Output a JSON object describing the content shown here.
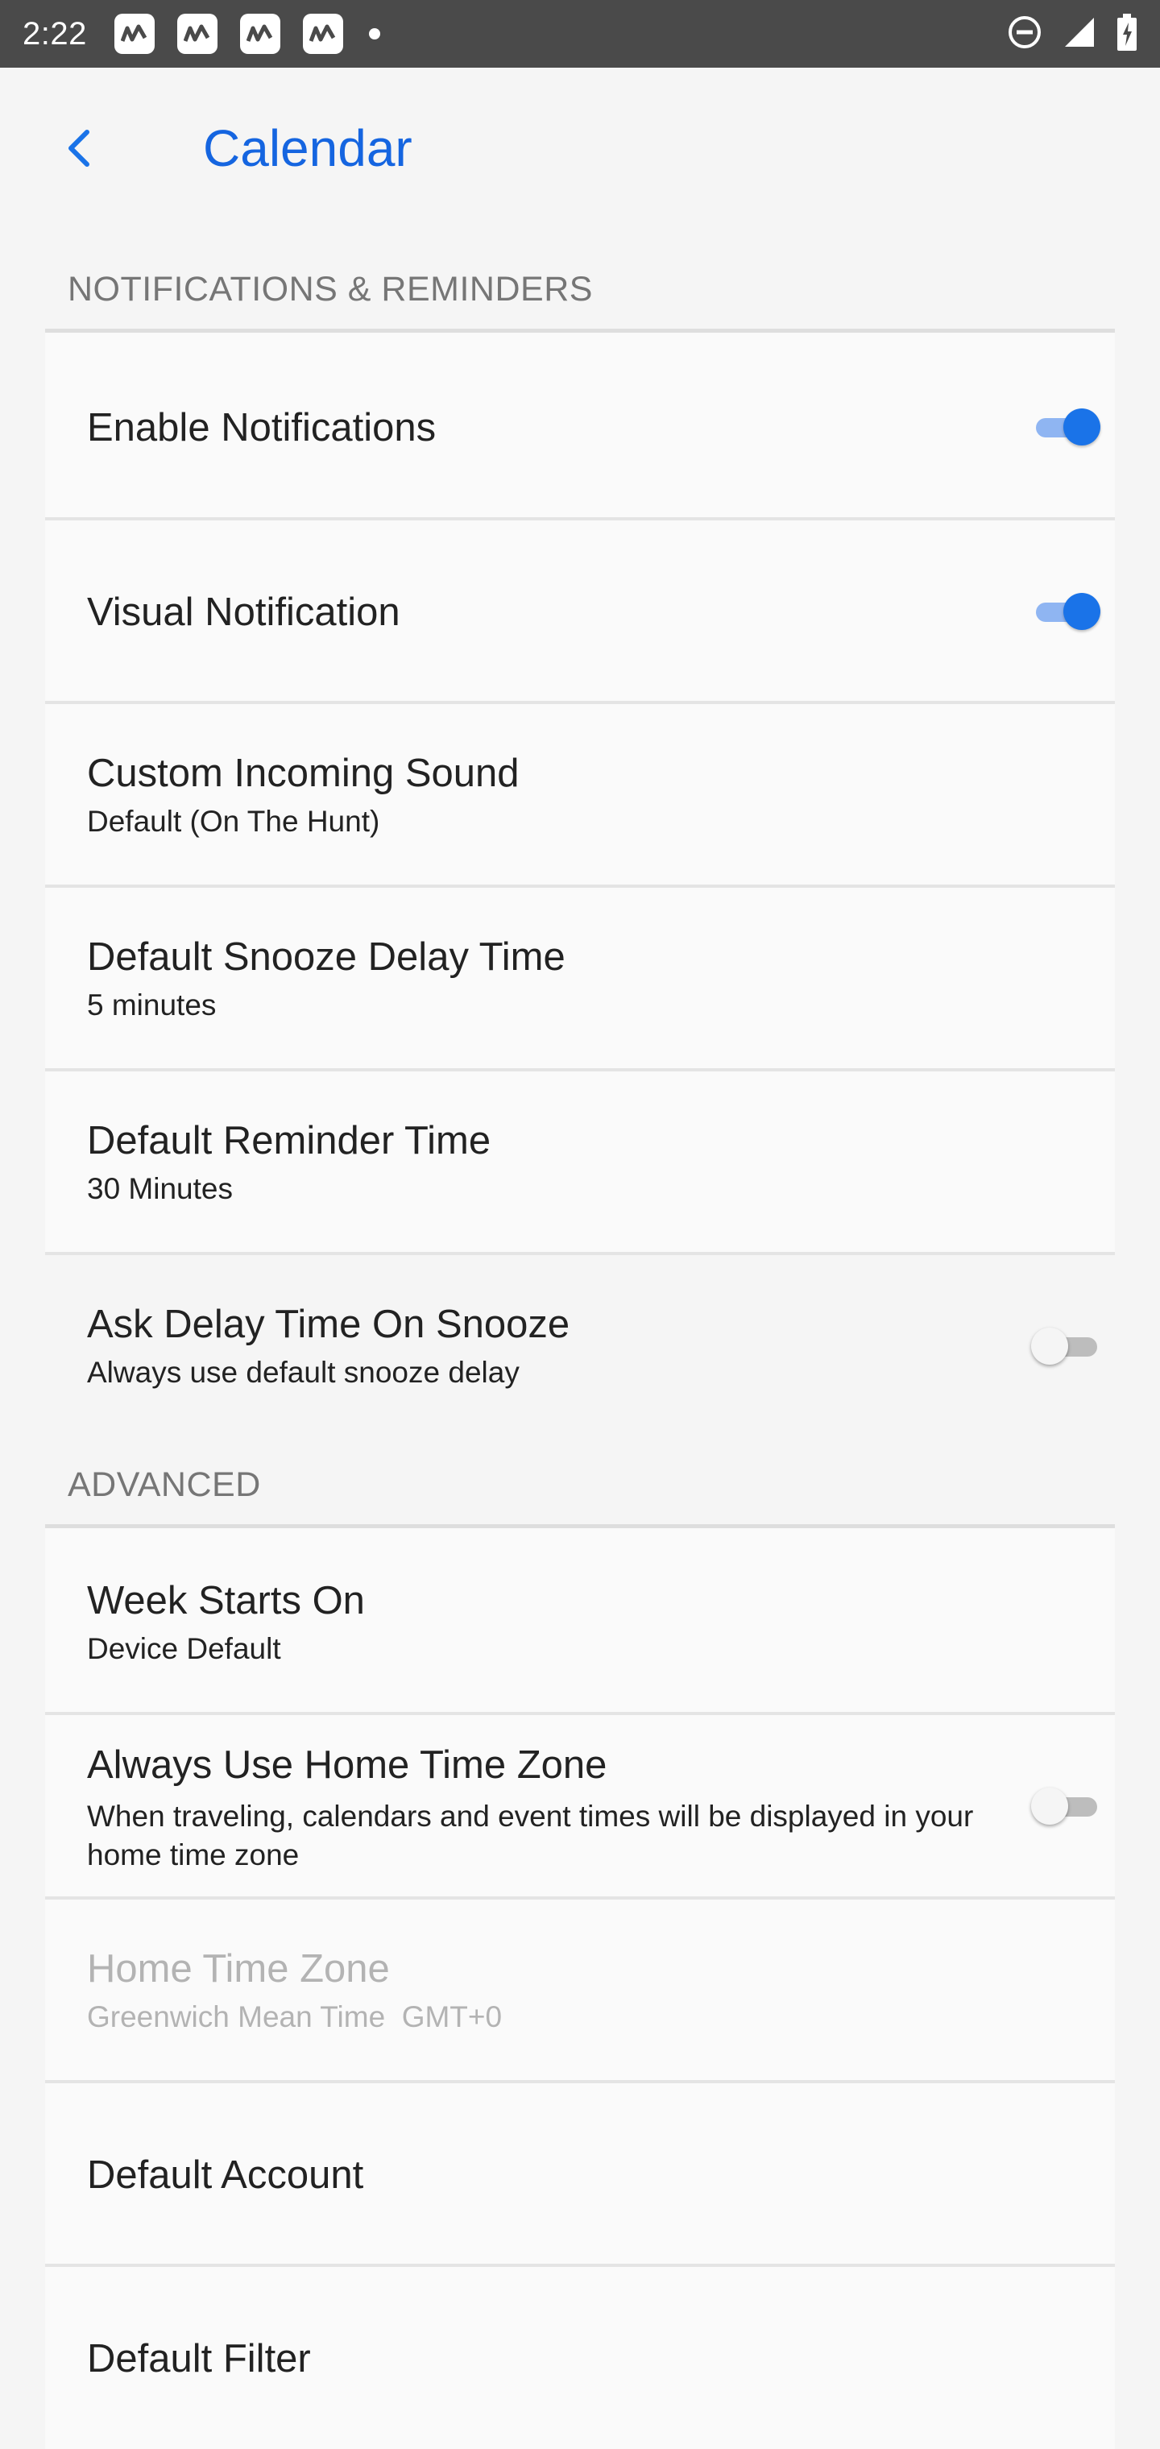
{
  "status_bar": {
    "time": "2:22",
    "notification_icons": [
      "app-notification-icon",
      "app-notification-icon",
      "app-notification-icon",
      "app-notification-icon"
    ],
    "system_icons": [
      "do-not-disturb-icon",
      "signal-icon",
      "battery-icon"
    ]
  },
  "app_bar": {
    "title": "Calendar",
    "back_icon": "back-arrow-icon"
  },
  "sections": {
    "notifications": {
      "header": "NOTIFICATIONS & REMINDERS",
      "items": [
        {
          "label": "Enable Notifications",
          "switch": true
        },
        {
          "label": "Visual Notification",
          "switch": true
        },
        {
          "label": "Custom Incoming Sound",
          "summary": "Default (On The Hunt)"
        },
        {
          "label": "Default Snooze Delay Time",
          "summary": "5 minutes"
        },
        {
          "label": "Default Reminder Time",
          "summary": "30 Minutes"
        },
        {
          "label": "Ask Delay Time On Snooze",
          "summary": "Always use default snooze delay",
          "switch": false
        }
      ]
    },
    "advanced": {
      "header": "ADVANCED",
      "items": [
        {
          "label": "Week Starts On",
          "summary": "Device Default"
        },
        {
          "label": "Always Use Home Time Zone",
          "summary": "When traveling, calendars and event times will be displayed in your home time zone",
          "switch": false
        },
        {
          "label": "Home Time Zone",
          "summary": "Greenwich Mean Time  GMT+0",
          "enabled": false
        },
        {
          "label": "Default Account"
        },
        {
          "label": "Default Filter"
        }
      ]
    }
  },
  "colors": {
    "accent": "#1a73e8",
    "status_bar": "#4a4a4a",
    "section_header": "#767676",
    "disabled_text": "#b3b3b3"
  }
}
